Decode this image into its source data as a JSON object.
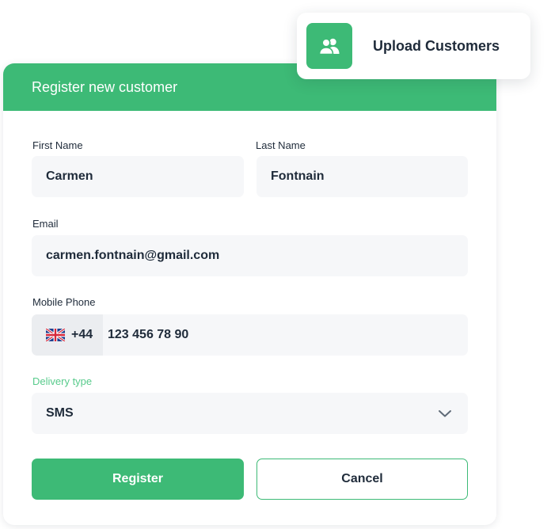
{
  "colors": {
    "accent": "#3dba76",
    "text": "#1f2b3a",
    "field_bg": "#f6f7f9",
    "prefix_bg": "#ebedf0",
    "focus_label": "#58cb8c"
  },
  "upload": {
    "label": "Upload Customers",
    "icon": "users-icon"
  },
  "form": {
    "title": "Register new customer",
    "first_name": {
      "label": "First Name",
      "value": "Carmen"
    },
    "last_name": {
      "label": "Last Name",
      "value": "Fontnain"
    },
    "email": {
      "label": "Email",
      "value": "carmen.fontnain@gmail.com"
    },
    "phone": {
      "label": "Mobile Phone",
      "flag_icon": "uk-flag-icon",
      "country_code": "+44",
      "number": "123 456 78 90"
    },
    "delivery": {
      "label": "Delivery type",
      "value": "SMS",
      "icon": "chevron-down-icon"
    },
    "register_label": "Register",
    "cancel_label": "Cancel"
  }
}
